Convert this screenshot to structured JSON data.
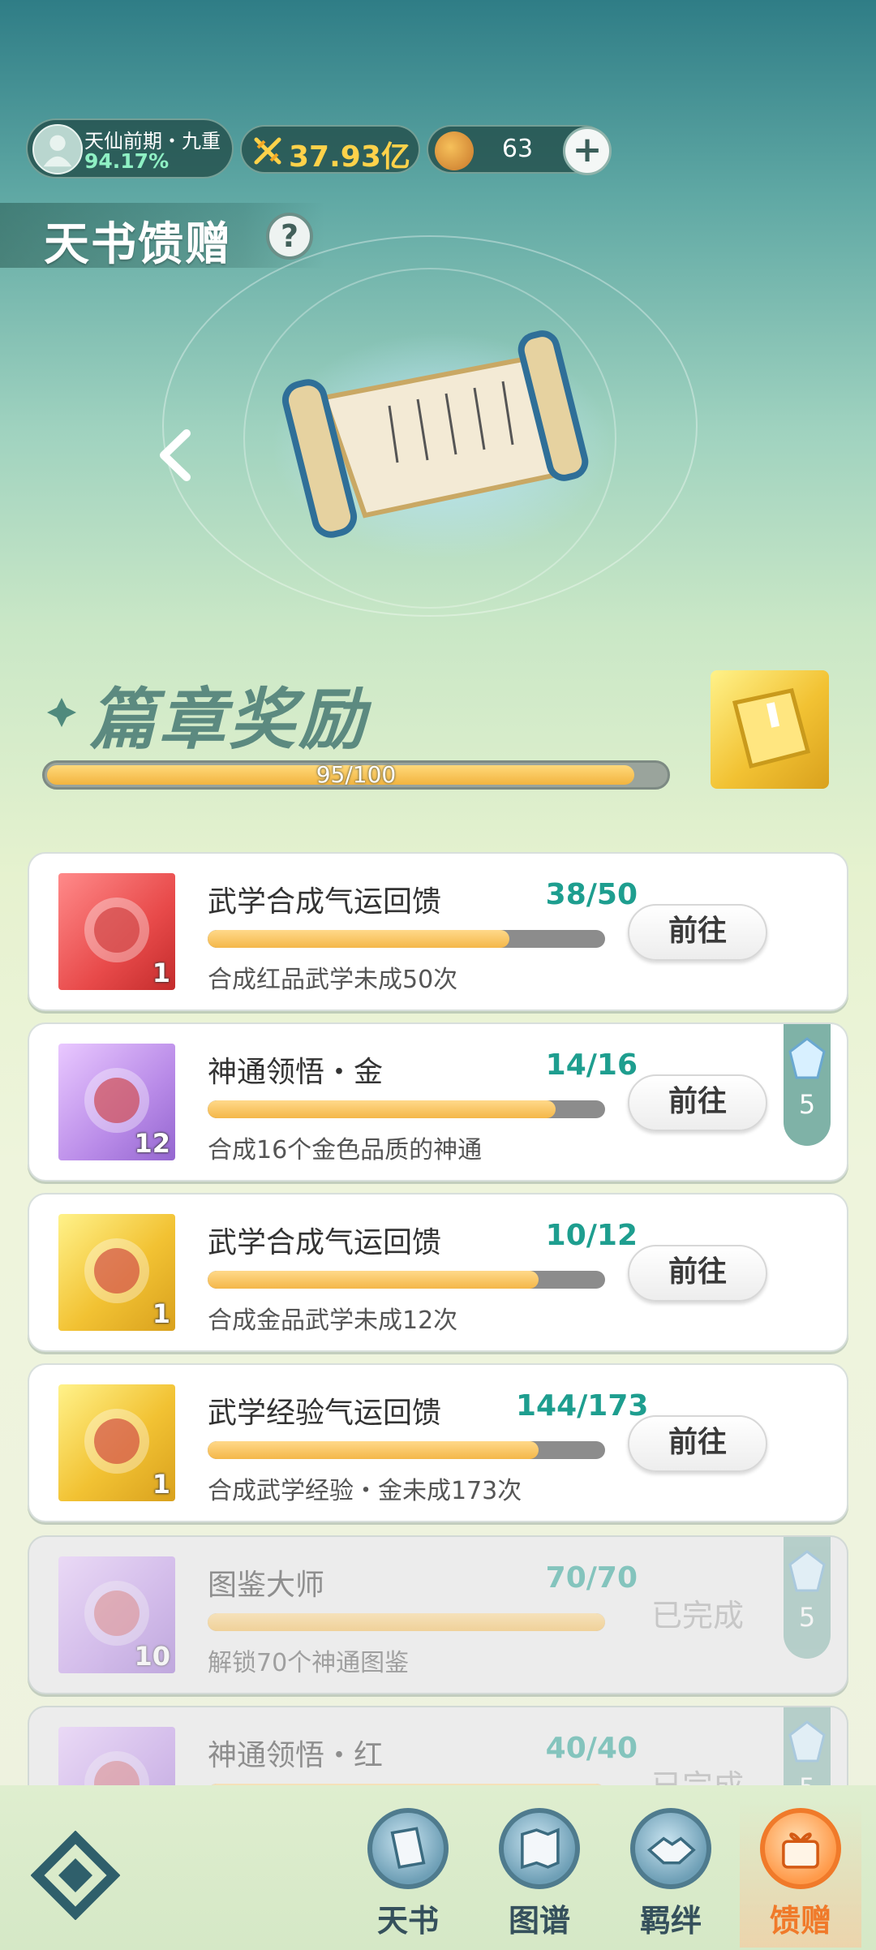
{
  "status": {
    "rank_name": "天仙前期・九重",
    "rank_percent": "94.17%",
    "power": "37.93亿",
    "coins": "63",
    "plus_label": "+"
  },
  "page_title": "天书馈赠",
  "help_label": "?",
  "chapter": {
    "title": "篇章奖励",
    "progress_text": "95/100",
    "progress_fraction": 0.95
  },
  "tasks": [
    {
      "name": "武学合成气运回馈",
      "progress": "38/50",
      "fraction": 0.76,
      "desc": "合成红品武学未成50次",
      "count": "1",
      "item_color": "red",
      "action": "前往",
      "done": false,
      "tag": ""
    },
    {
      "name": "神通领悟・金",
      "progress": "14/16",
      "fraction": 0.875,
      "desc": "合成16个金色品质的神通",
      "count": "12",
      "item_color": "purple",
      "action": "前往",
      "done": false,
      "tag": "5"
    },
    {
      "name": "武学合成气运回馈",
      "progress": "10/12",
      "fraction": 0.833,
      "desc": "合成金品武学未成12次",
      "count": "1",
      "item_color": "gold",
      "action": "前往",
      "done": false,
      "tag": ""
    },
    {
      "name": "武学经验气运回馈",
      "progress": "144/173",
      "fraction": 0.832,
      "desc": "合成武学经验・金未成173次",
      "count": "1",
      "item_color": "gold",
      "action": "前往",
      "done": false,
      "tag": ""
    },
    {
      "name": "图鉴大师",
      "progress": "70/70",
      "fraction": 1.0,
      "desc": "解锁70个神通图鉴",
      "count": "10",
      "item_color": "purple",
      "action": "已完成",
      "done": true,
      "tag": "5"
    },
    {
      "name": "神通领悟・红",
      "progress": "40/40",
      "fraction": 1.0,
      "desc": "",
      "count": "",
      "item_color": "purple",
      "action": "已完成",
      "done": true,
      "tag": "5"
    }
  ],
  "nav": {
    "items": [
      {
        "label": "天书",
        "icon": "book-icon",
        "active": false
      },
      {
        "label": "图谱",
        "icon": "map-icon",
        "active": false
      },
      {
        "label": "羁绊",
        "icon": "handshake-icon",
        "active": false
      },
      {
        "label": "馈赠",
        "icon": "gift-icon",
        "active": true
      }
    ]
  },
  "colors": {
    "accent_teal": "#1e9e8f",
    "progress_gold": "#f4b749",
    "active_orange": "#f07a2a"
  }
}
